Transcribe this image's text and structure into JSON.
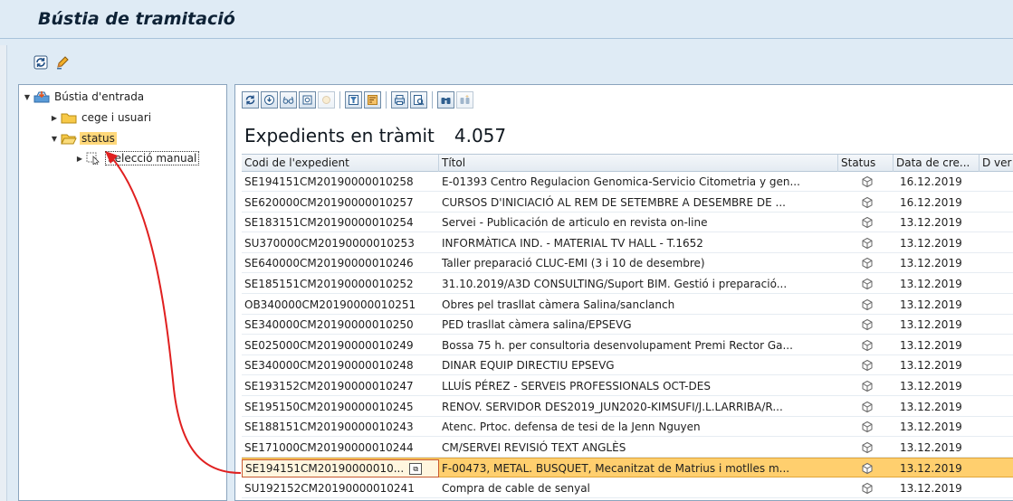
{
  "window": {
    "title": "Bústia de tramitació"
  },
  "toolbar": {
    "icons": [
      "refresh-icon",
      "edit-pencil-icon"
    ]
  },
  "tree": {
    "root": {
      "label": "Bústia d'entrada"
    },
    "children": [
      {
        "label": "cege i usuari"
      },
      {
        "label": "status"
      }
    ],
    "grandchild": {
      "label": "Selecció manual"
    }
  },
  "alv": {
    "toolbar_icons": [
      "refresh-icon",
      "details-icon",
      "glasses-icon",
      "settings-icon",
      "disabled-icon",
      "filter-icon",
      "sort-icon",
      "print-icon",
      "preview-icon",
      "find-icon",
      "find-next-icon"
    ],
    "title": "Expedients en tràmit",
    "count": "4.057",
    "columns": [
      "Codi de l'expedient",
      "Títol",
      "Status",
      "Data de cre...",
      "D ver"
    ],
    "rows": [
      {
        "code": "SE194151CM20190000010258",
        "title": "E-01393 Centro Regulacion Genomica-Servicio Citometria y gen...",
        "date": "16.12.2019"
      },
      {
        "code": "SE620000CM20190000010257",
        "title": "CURSOS D'INICIACIÓ AL REM DE SETEMBRE A DESEMBRE DE ...",
        "date": "16.12.2019"
      },
      {
        "code": "SE183151CM20190000010254",
        "title": "Servei - Publicación de articulo en revista on-line",
        "date": "13.12.2019"
      },
      {
        "code": "SU370000CM20190000010253",
        "title": "INFORMÀTICA IND. - MATERIAL TV HALL - T.1652",
        "date": "13.12.2019"
      },
      {
        "code": "SE640000CM20190000010246",
        "title": "Taller preparació CLUC-EMI (3 i 10 de desembre)",
        "date": "13.12.2019"
      },
      {
        "code": "SE185151CM20190000010252",
        "title": "31.10.2019/A3D CONSULTING/Suport BIM. Gestió i preparació...",
        "date": "13.12.2019"
      },
      {
        "code": "OB340000CM20190000010251",
        "title": "Obres pel trasllat càmera Salina/sanclanch",
        "date": "13.12.2019"
      },
      {
        "code": "SE340000CM20190000010250",
        "title": "PED trasllat càmera salina/EPSEVG",
        "date": "13.12.2019"
      },
      {
        "code": "SE025000CM20190000010249",
        "title": "Bossa 75 h. per consultoria desenvolupament Premi Rector Ga...",
        "date": "13.12.2019"
      },
      {
        "code": "SE340000CM20190000010248",
        "title": "DINAR EQUIP DIRECTIU EPSEVG",
        "date": "13.12.2019"
      },
      {
        "code": "SE193152CM20190000010247",
        "title": "LLUÍS PÉREZ - SERVEIS PROFESSIONALS OCT-DES",
        "date": "13.12.2019"
      },
      {
        "code": "SE195150CM20190000010245",
        "title": "RENOV. SERVIDOR DES2019_JUN2020-KIMSUFI/J.L.LARRIBA/R...",
        "date": "13.12.2019"
      },
      {
        "code": "SE188151CM20190000010243",
        "title": "Atenc. Prtoc.  defensa de tesi de la Jenn Nguyen",
        "date": "13.12.2019"
      },
      {
        "code": "SE171000CM20190000010244",
        "title": "CM/SERVEI REVISIÓ TEXT ANGLÈS",
        "date": "13.12.2019"
      },
      {
        "code": "SE194151CM20190000010...",
        "title": "F-00473, METAL. BUSQUET, Mecanitzat de Matrius i motlles m...",
        "date": "13.12.2019",
        "selected": true
      },
      {
        "code": "SU192152CM20190000010241",
        "title": "Compra de cable de senyal",
        "date": "13.12.2019"
      }
    ]
  },
  "colors": {
    "selected_row": "#ffcf6e",
    "annotation_arrow": "#e02020",
    "background": "#dfebf5"
  }
}
